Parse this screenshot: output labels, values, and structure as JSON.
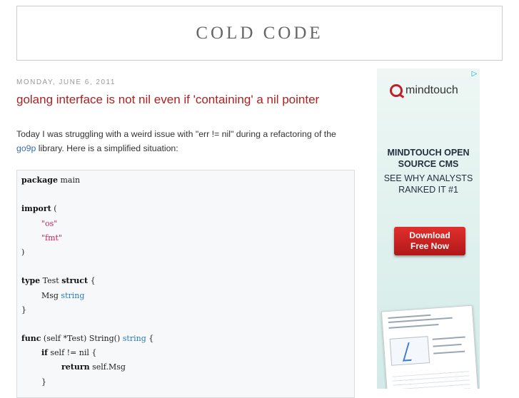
{
  "blog": {
    "title": "COLD CODE"
  },
  "post": {
    "date": "MONDAY, JUNE 6, 2011",
    "title": "golang interface is not nil even if 'containing' a nil pointer",
    "intro_before": "Today I was struggling with a weird issue with \"err != nil\" during a refactoring of the ",
    "intro_link": "go9p",
    "intro_after": " library. Here is a simplified situation:"
  },
  "code": {
    "l1_kw": "package",
    "l1_rest": " main",
    "l3_kw": "import",
    "l3_rest": " (",
    "l4_indent": "        ",
    "l4_str": "\"os\"",
    "l5_indent": "        ",
    "l5_str": "\"fmt\"",
    "l6": ")",
    "l8_kw1": "type",
    "l8_mid": " Test ",
    "l8_kw2": "struct",
    "l8_rest": " {",
    "l9_indent": "        Msg ",
    "l9_type": "string",
    "l10": "}",
    "l12_kw": "func",
    "l12_mid": " (self *Test) String() ",
    "l12_type": "string",
    "l12_rest": " {",
    "l13_indent": "        ",
    "l13_kw": "if",
    "l13_rest": " self != nil {",
    "l14_indent": "                ",
    "l14_kw": "return",
    "l14_rest": " self.Msg",
    "l15": "        }"
  },
  "ad": {
    "choices_icon": "ad-choices-icon",
    "brand": "mindtouch",
    "headline_line1": "MINDTOUCH OPEN",
    "headline_line2": "SOURCE CMS",
    "sub_line1": "SEE WHY ANALYSTS",
    "sub_line2": "RANKED IT #1",
    "button_line1": "Download",
    "button_line2": "Free Now"
  },
  "colors": {
    "title_red": "#aa2222",
    "link_blue": "#3a6fb0",
    "code_string": "#cc2255",
    "code_type": "#2b7bb9",
    "ad_button": "#c8201f"
  }
}
